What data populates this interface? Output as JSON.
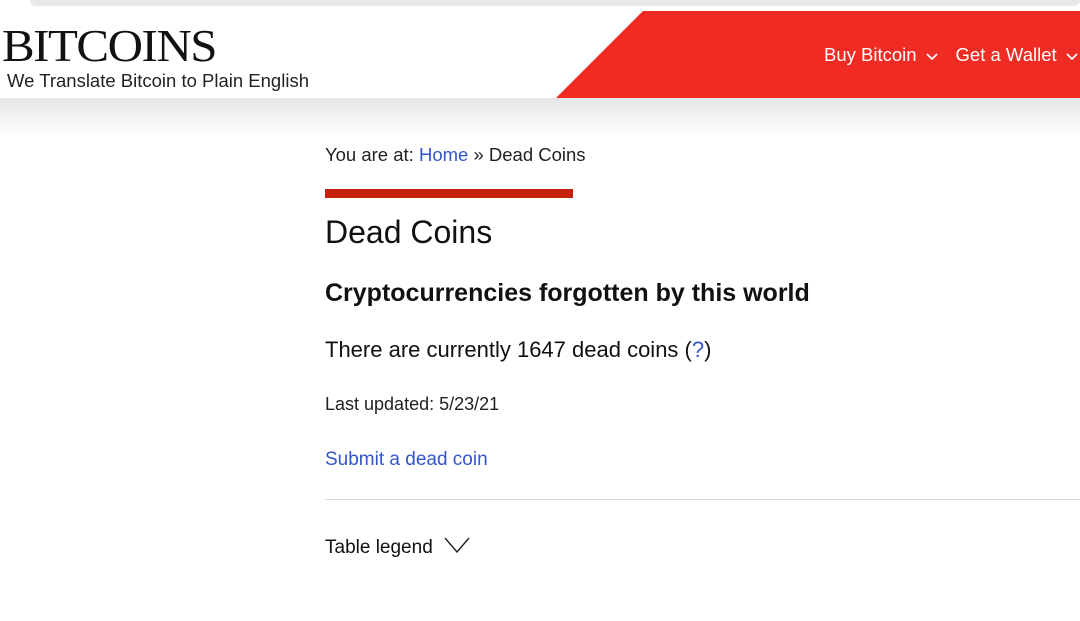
{
  "header": {
    "logo_text": "BITCOINS",
    "tagline": "We Translate Bitcoin to Plain English",
    "nav": [
      {
        "label": "Buy Bitcoin",
        "icon": "chevron-down-icon"
      },
      {
        "label": "Get a Wallet",
        "icon": "chevron-down-icon"
      }
    ],
    "accent_color": "#ef2b24"
  },
  "breadcrumb": {
    "prefix": "You are at:",
    "home": "Home",
    "separator": "»",
    "current": "Dead Coins"
  },
  "main": {
    "title": "Dead Coins",
    "subtitle": "Cryptocurrencies forgotten by this world",
    "count_prefix": "There are currently 1647 dead coins (",
    "count_help": "?",
    "count_suffix": ")",
    "last_updated": "Last updated: 5/23/21",
    "submit_link": "Submit a dead coin",
    "legend_label": "Table legend",
    "accent_bar_color": "#c4210f"
  }
}
